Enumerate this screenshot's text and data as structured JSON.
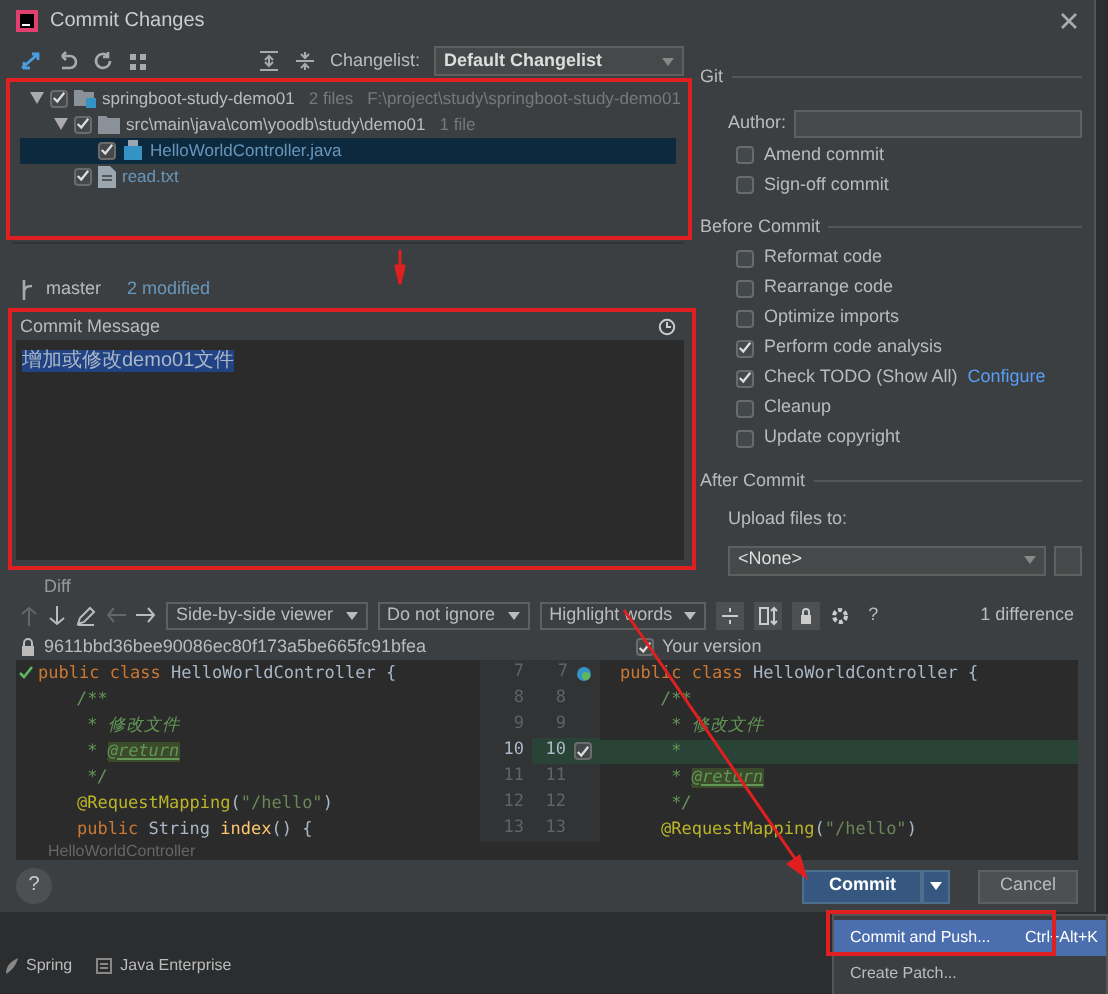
{
  "window": {
    "title": "Commit Changes"
  },
  "changelist": {
    "label": "Changelist:",
    "value": "Default Changelist"
  },
  "tree": [
    {
      "kind": "module",
      "name": "springboot-study-demo01",
      "count": "2 files",
      "path": "F:\\project\\study\\springboot-study-demo01",
      "checked": true,
      "expanded": true,
      "selected": false,
      "children": [
        {
          "kind": "folder",
          "name": "src\\main\\java\\com\\yoodb\\study\\demo01",
          "count": "1 file",
          "checked": true,
          "expanded": true,
          "selected": false,
          "children": [
            {
              "kind": "java",
              "name": "HelloWorldController.java",
              "checked": true,
              "selected": true
            }
          ]
        },
        {
          "kind": "text",
          "name": "read.txt",
          "checked": true,
          "selected": false
        }
      ]
    }
  ],
  "branch": {
    "name": "master",
    "summary": "2 modified"
  },
  "commit_message": {
    "label": "Commit Message",
    "value": "增加或修改demo01文件"
  },
  "diff_label": "Diff",
  "git": {
    "title": "Git",
    "author_label": "Author:",
    "options": [
      {
        "label": "Amend commit",
        "checked": false
      },
      {
        "label": "Sign-off commit",
        "checked": false
      }
    ]
  },
  "before_commit": {
    "title": "Before Commit",
    "options": [
      {
        "label": "Reformat code",
        "checked": false
      },
      {
        "label": "Rearrange code",
        "checked": false
      },
      {
        "label": "Optimize imports",
        "checked": false
      },
      {
        "label": "Perform code analysis",
        "checked": true
      },
      {
        "label": "Check TODO (Show All)",
        "checked": true,
        "link": "Configure"
      },
      {
        "label": "Cleanup",
        "checked": false
      },
      {
        "label": "Update copyright",
        "checked": false
      }
    ]
  },
  "after_commit": {
    "title": "After Commit",
    "upload_label": "Upload files to:",
    "upload_value": "<None>"
  },
  "diff": {
    "viewer": "Side-by-side viewer",
    "ignore": "Do not ignore",
    "highlight": "Highlight words",
    "help": "?",
    "differences": "1 difference",
    "left_title": "9611bbd36bee90086ec80f173a5be665fc91bfea",
    "right_title": "Your version",
    "right_checked": true,
    "rows": [
      {
        "left_num": "7",
        "right_num": "7",
        "changed": false,
        "left": [
          {
            "t": "public class ",
            "kind": "kw"
          },
          {
            "t": "HelloWorldController {",
            "kind": "pl"
          }
        ],
        "right": [
          {
            "t": "public class ",
            "kind": "kw"
          },
          {
            "t": "HelloWorldController {",
            "kind": "pl"
          }
        ]
      },
      {
        "left_num": "8",
        "right_num": "8",
        "changed": false,
        "left": [
          {
            "t": "    /**",
            "kind": "cm"
          }
        ],
        "right": [
          {
            "t": "    /**",
            "kind": "cm"
          }
        ]
      },
      {
        "left_num": "9",
        "right_num": "9",
        "changed": false,
        "left": [
          {
            "t": "     * 修改文件",
            "kind": "cm"
          }
        ],
        "right": [
          {
            "t": "     * 修改文件",
            "kind": "cm"
          }
        ]
      },
      {
        "left_num": "10",
        "right_num": "10",
        "changed": true,
        "left": [
          {
            "t": "     * ",
            "kind": "cm"
          },
          {
            "t": "@return",
            "kind": "tag"
          }
        ],
        "right": [
          {
            "t": "     *",
            "kind": "cm"
          }
        ]
      },
      {
        "left_num": "11",
        "right_num": "11",
        "changed": false,
        "left": [
          {
            "t": "     */",
            "kind": "cm"
          }
        ],
        "right": [
          {
            "t": "     * ",
            "kind": "cm"
          },
          {
            "t": "@return",
            "kind": "tag"
          }
        ]
      },
      {
        "left_num": "12",
        "right_num": "12",
        "changed": false,
        "left": [
          {
            "t": "    @RequestMapping",
            "kind": "an"
          },
          {
            "t": "(",
            "kind": "pl"
          },
          {
            "t": "\"/hello\"",
            "kind": "str"
          },
          {
            "t": ")",
            "kind": "pl"
          }
        ],
        "right": [
          {
            "t": "     */",
            "kind": "cm"
          }
        ]
      },
      {
        "left_num": "13",
        "right_num": "13",
        "changed": false,
        "left": [
          {
            "t": "    public ",
            "kind": "kw"
          },
          {
            "t": "String ",
            "kind": "pl"
          },
          {
            "t": "index",
            "kind": "fn"
          },
          {
            "t": "() {",
            "kind": "pl"
          }
        ],
        "right": [
          {
            "t": "    @RequestMapping",
            "kind": "an"
          },
          {
            "t": "(",
            "kind": "pl"
          },
          {
            "t": "\"/hello\"",
            "kind": "str"
          },
          {
            "t": ")",
            "kind": "pl"
          }
        ]
      }
    ],
    "breadcrumb": "HelloWorldController"
  },
  "buttons": {
    "help": "?",
    "commit": "Commit",
    "cancel": "Cancel"
  },
  "ide": {
    "tool_tabs": [
      "Spring",
      "Java Enterprise"
    ]
  },
  "menu": [
    {
      "label": "Commit and Push...",
      "shortcut": "Ctrl+Alt+K",
      "selected": true
    },
    {
      "label": "Create Patch...",
      "selected": false
    }
  ]
}
